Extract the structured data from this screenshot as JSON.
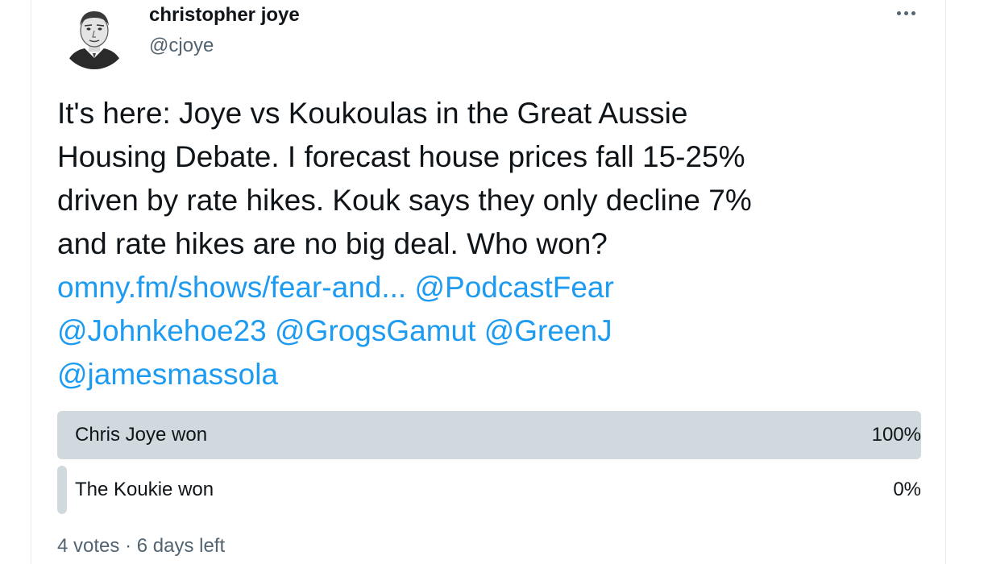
{
  "author": {
    "display_name": "christopher joye",
    "handle": "@cjoye"
  },
  "tweet": {
    "text_lines": [
      "It's here: Joye vs Koukoulas in the Great Aussie",
      "Housing Debate. I forecast house prices fall 15-25%",
      "driven by rate hikes. Kouk says they only decline 7%",
      "and rate hikes are no big deal. Who won?"
    ],
    "link": "omny.fm/shows/fear-and...",
    "mentions": [
      "@PodcastFear",
      "@Johnkehoe23",
      "@GrogsGamut",
      "@GreenJ",
      "@jamesmassola"
    ]
  },
  "poll": {
    "options": [
      {
        "label": "Chris Joye won",
        "percent_text": "100%",
        "share": 1.0
      },
      {
        "label": "The Koukie won",
        "percent_text": "0%",
        "share": 0.0
      }
    ],
    "votes": "4 votes",
    "separator": "·",
    "time_left": "6 days left"
  },
  "colors": {
    "link": "#1d9bf0",
    "text": "#0f1419",
    "secondary": "#536471",
    "poll_bar": "#cfd9de"
  },
  "icons": {
    "more": "more-horizontal-icon"
  }
}
